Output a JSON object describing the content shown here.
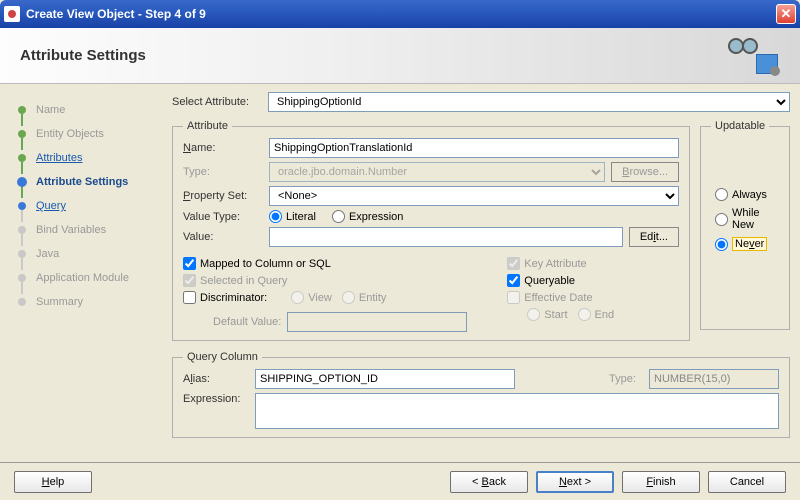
{
  "window": {
    "title": "Create View Object - Step 4 of 9"
  },
  "header": {
    "title": "Attribute Settings"
  },
  "steps": [
    {
      "label": "Name",
      "state": "visited"
    },
    {
      "label": "Entity Objects",
      "state": "visited"
    },
    {
      "label": "Attributes",
      "state": "visited link"
    },
    {
      "label": "Attribute Settings",
      "state": "current"
    },
    {
      "label": "Query",
      "state": "next link"
    },
    {
      "label": "Bind Variables",
      "state": "pending"
    },
    {
      "label": "Java",
      "state": "pending"
    },
    {
      "label": "Application Module",
      "state": "pending"
    },
    {
      "label": "Summary",
      "state": "pending"
    }
  ],
  "selectAttribute": {
    "label": "Select Attribute:",
    "value": "ShippingOptionId"
  },
  "attribute": {
    "legend": "Attribute",
    "name": {
      "label": "Name:",
      "value": "ShippingOptionTranslationId"
    },
    "type": {
      "label": "Type:",
      "value": "oracle.jbo.domain.Number",
      "browse": "Browse..."
    },
    "propertySet": {
      "label": "Property Set:",
      "value": "<None>"
    },
    "valueType": {
      "label": "Value Type:",
      "literal": "Literal",
      "expression": "Expression"
    },
    "value": {
      "label": "Value:",
      "value": "",
      "edit": "Edit..."
    },
    "checks": {
      "mapped": "Mapped to Column or SQL",
      "selected": "Selected in Query",
      "discriminator": "Discriminator:",
      "view": "View",
      "entity": "Entity",
      "defaultValue": "Default Value:",
      "keyAttribute": "Key Attribute",
      "queryable": "Queryable",
      "effectiveDate": "Effective Date",
      "start": "Start",
      "end": "End"
    }
  },
  "updatable": {
    "legend": "Updatable",
    "always": "Always",
    "whileNew": "While New",
    "never": "Never"
  },
  "queryColumn": {
    "legend": "Query Column",
    "alias": {
      "label": "Alias:",
      "value": "SHIPPING_OPTION_ID"
    },
    "type": {
      "label": "Type:",
      "value": "NUMBER(15,0)"
    },
    "expression": {
      "label": "Expression:",
      "value": ""
    }
  },
  "footer": {
    "help": "Help",
    "back": "< Back",
    "next": "Next >",
    "finish": "Finish",
    "cancel": "Cancel"
  }
}
